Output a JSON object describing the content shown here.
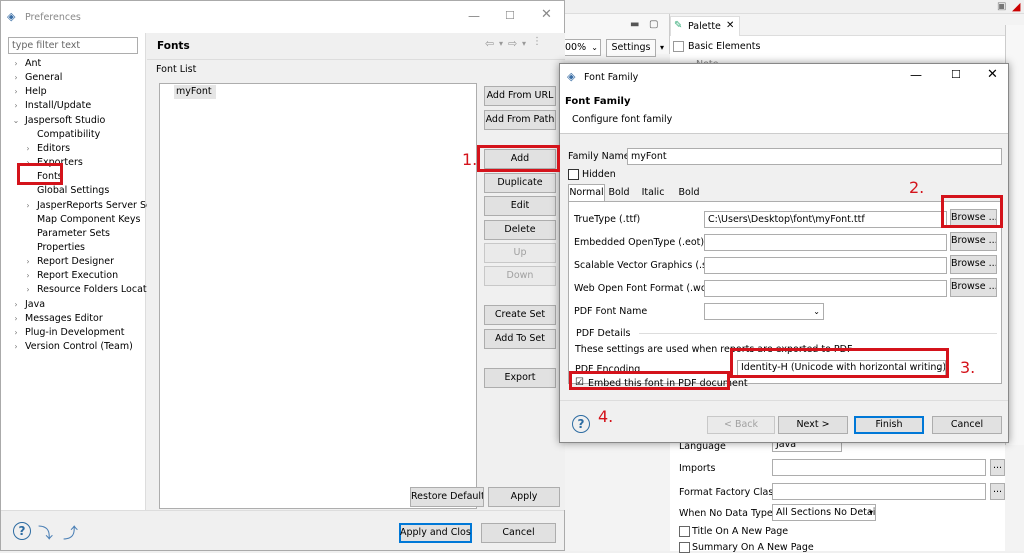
{
  "prefs": {
    "title": "Preferences",
    "filter_placeholder": "type filter text",
    "tree": [
      {
        "label": "Ant",
        "indent": 0,
        "arrow": "›"
      },
      {
        "label": "General",
        "indent": 0,
        "arrow": "›"
      },
      {
        "label": "Help",
        "indent": 0,
        "arrow": "›"
      },
      {
        "label": "Install/Update",
        "indent": 0,
        "arrow": "›"
      },
      {
        "label": "Jaspersoft Studio",
        "indent": 0,
        "arrow": "⌄"
      },
      {
        "label": "Compatibility",
        "indent": 1,
        "arrow": ""
      },
      {
        "label": "Editors",
        "indent": 1,
        "arrow": "›"
      },
      {
        "label": "Exporters",
        "indent": 1,
        "arrow": "›"
      },
      {
        "label": "Fonts",
        "indent": 1,
        "arrow": ""
      },
      {
        "label": "Global Settings",
        "indent": 1,
        "arrow": ""
      },
      {
        "label": "JasperReports Server Sett",
        "indent": 1,
        "arrow": "›"
      },
      {
        "label": "Map Component Keys",
        "indent": 1,
        "arrow": ""
      },
      {
        "label": "Parameter Sets",
        "indent": 1,
        "arrow": ""
      },
      {
        "label": "Properties",
        "indent": 1,
        "arrow": ""
      },
      {
        "label": "Report Designer",
        "indent": 1,
        "arrow": "›"
      },
      {
        "label": "Report Execution",
        "indent": 1,
        "arrow": "›"
      },
      {
        "label": "Resource Folders Locatic",
        "indent": 1,
        "arrow": "›"
      },
      {
        "label": "Java",
        "indent": 0,
        "arrow": "›"
      },
      {
        "label": "Messages Editor",
        "indent": 0,
        "arrow": "›"
      },
      {
        "label": "Plug-in Development",
        "indent": 0,
        "arrow": "›"
      },
      {
        "label": "Version Control (Team)",
        "indent": 0,
        "arrow": "›"
      }
    ],
    "page_title": "Fonts",
    "font_list_label": "Font List",
    "font_items": [
      "myFont"
    ],
    "buttons": {
      "add_from_url": "Add From URL",
      "add_from_path": "Add From Path",
      "add": "Add",
      "duplicate": "Duplicate",
      "edit": "Edit",
      "delete": "Delete",
      "up": "Up",
      "down": "Down",
      "create_set": "Create Set",
      "add_to_set": "Add To Set",
      "export": "Export",
      "restore_defaults": "Restore Defaults",
      "apply": "Apply",
      "apply_close": "Apply and Close",
      "cancel": "Cancel"
    }
  },
  "ide": {
    "zoom": "00%",
    "settings": "Settings",
    "palette_tab": "Palette",
    "basic_elements": "Basic Elements",
    "note": "Note",
    "language_label": "Language",
    "language_value": "Java",
    "imports_label": "Imports",
    "format_factory_label": "Format Factory Class",
    "when_no_data_label": "When No Data Type",
    "when_no_data_value": "All Sections No Detail",
    "title_on_new_page": "Title On A New Page",
    "summary_on_new_page": "Summary On A New Page"
  },
  "dialog": {
    "title": "Font Family",
    "header_title": "Font Family",
    "header_subtitle": "Configure font family",
    "family_name_label": "Family Name",
    "family_name_value": "myFont",
    "hidden_label": "Hidden",
    "tabs": [
      "Normal",
      "Bold",
      "Italic",
      "Bold Italic"
    ],
    "rows": [
      {
        "label": "TrueType (.ttf)",
        "value": "C:\\Users\\Desktop\\font\\myFont.ttf"
      },
      {
        "label": "Embedded OpenType (.eot)",
        "value": ""
      },
      {
        "label": "Scalable Vector Graphics (.svg)",
        "value": ""
      },
      {
        "label": "Web Open Font Format (.woff)",
        "value": ""
      }
    ],
    "browse": "Browse ...",
    "pdf_font_name_label": "PDF Font Name",
    "pdf_details_label": "PDF Details",
    "pdf_note": "These settings are used when reports are exported to PDF",
    "pdf_encoding_label": "PDF Encoding",
    "pdf_encoding_value": "Identity-H (Unicode with horizontal writing)",
    "embed_label": "Embed this font in PDF document",
    "embed_checked": "☑",
    "back": "< Back",
    "next": "Next >",
    "finish": "Finish",
    "cancel": "Cancel"
  },
  "annotations": [
    "1.",
    "2.",
    "3.",
    "4."
  ],
  "colors": {
    "accent_red": "#d4131b",
    "selection": "#cce8ff",
    "blue": "#0078d7"
  }
}
